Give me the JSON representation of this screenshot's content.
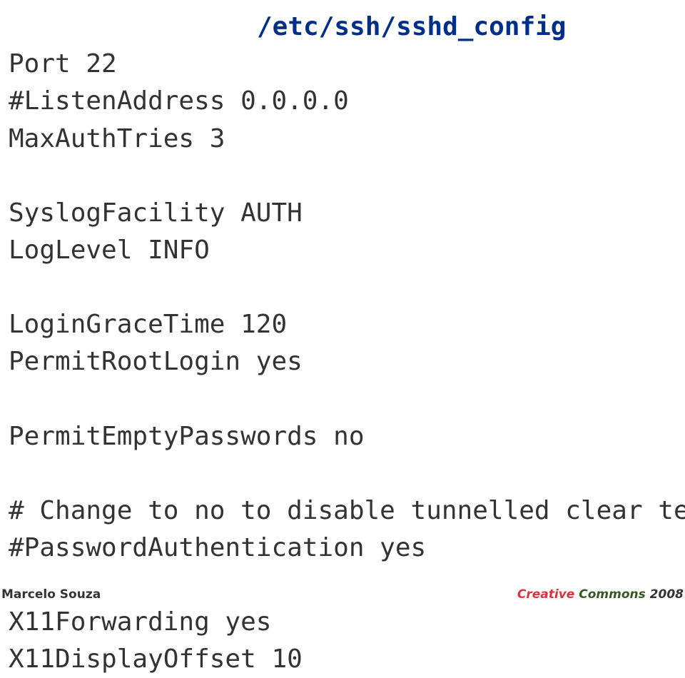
{
  "title": "/etc/ssh/sshd_config",
  "lines": {
    "l0": "Port 22",
    "l1": "#ListenAddress 0.0.0.0",
    "l2": "MaxAuthTries 3",
    "l3": "SyslogFacility AUTH",
    "l4": "LogLevel INFO",
    "l5": "LoginGraceTime 120",
    "l6": "PermitRootLogin yes",
    "l7": "PermitEmptyPasswords no",
    "l8": "# Change to no to disable tunnelled clear text pass",
    "l9": "#PasswordAuthentication yes",
    "l10": "X11Forwarding yes",
    "l11": "X11DisplayOffset 10"
  },
  "footer": {
    "author": "Marcelo Souza",
    "creative": "Creative",
    "commons": "Commons",
    "year": "2008"
  }
}
